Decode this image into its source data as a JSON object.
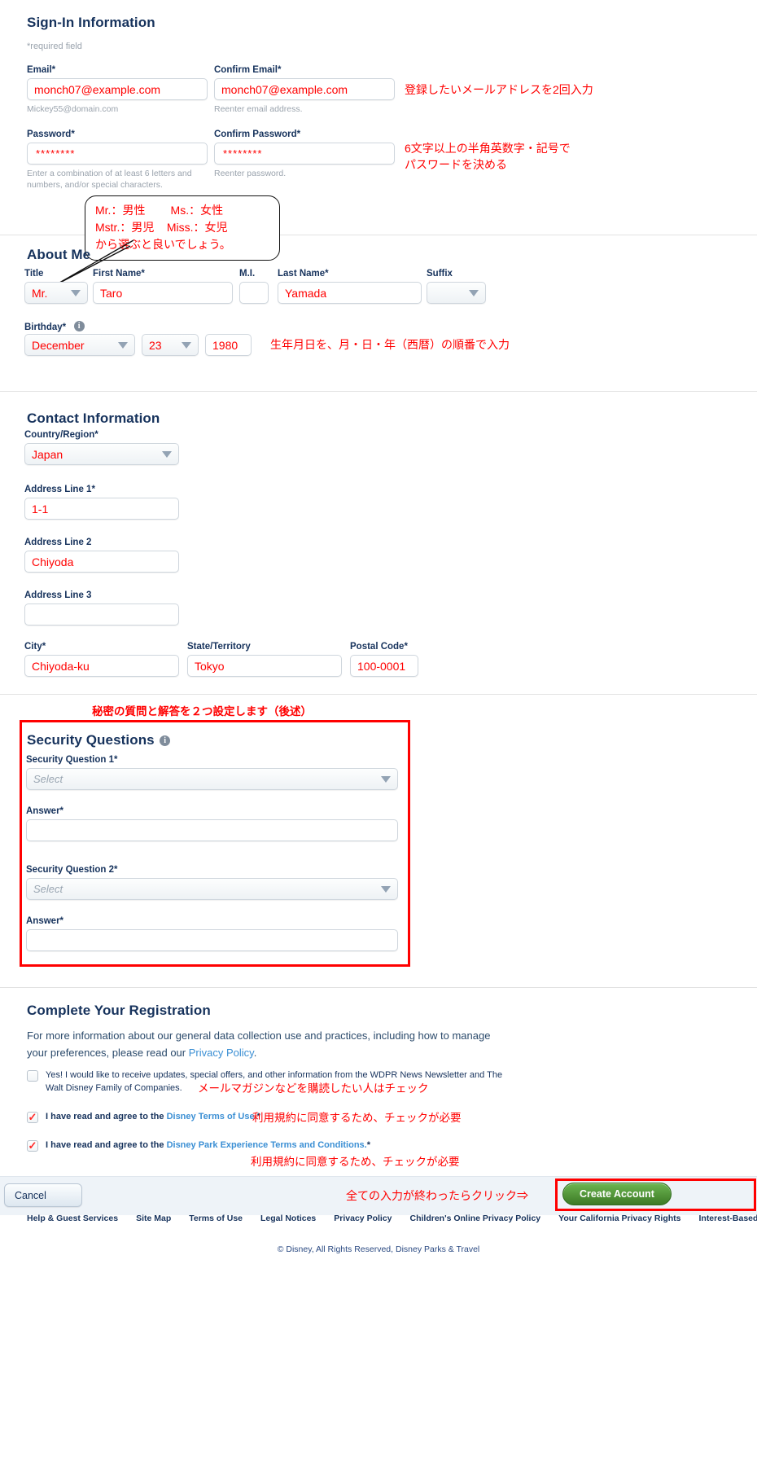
{
  "signin": {
    "heading": "Sign-In Information",
    "required_note": "*required field",
    "email_label": "Email*",
    "email_value": "monch07@example.com",
    "email_hint": "Mickey55@domain.com",
    "confirm_email_label": "Confirm Email*",
    "confirm_email_value": "monch07@example.com",
    "confirm_email_hint": "Reenter email address.",
    "password_label": "Password*",
    "password_value": "********",
    "password_hint": "Enter a combination of at least 6 letters and numbers, and/or special characters.",
    "confirm_password_label": "Confirm Password*",
    "confirm_password_value": "********",
    "confirm_password_hint": "Reenter password.",
    "anno_email": "登録したいメールアドレスを2回入力",
    "anno_password": "6文字以上の半角英数字・記号で\nパスワードを決める"
  },
  "about": {
    "heading": "About Me",
    "title_label": "Title",
    "title_value": "Mr.",
    "first_label": "First Name*",
    "first_value": "Taro",
    "mi_label": "M.I.",
    "mi_value": "",
    "last_label": "Last Name*",
    "last_value": "Yamada",
    "suffix_label": "Suffix",
    "suffix_value": "",
    "birthday_label": "Birthday*",
    "birth_month": "December",
    "birth_day": "23",
    "birth_year": "1980",
    "anno_birthday": "生年月日を、月・日・年（西暦）の順番で入力",
    "bubble": "Mr.：男性        Ms.：女性\nMstr.：男児    Miss.：女児\nから選ぶと良いでしょう。"
  },
  "contact": {
    "heading": "Contact Information",
    "country_label": "Country/Region*",
    "country_value": "Japan",
    "addr1_label": "Address Line 1*",
    "addr1_value": "1-1",
    "addr2_label": "Address Line 2",
    "addr2_value": "Chiyoda",
    "addr3_label": "Address Line 3",
    "addr3_value": "",
    "city_label": "City*",
    "city_value": "Chiyoda-ku",
    "state_label": "State/Territory",
    "state_value": "Tokyo",
    "postal_label": "Postal Code*",
    "postal_value": "100-0001"
  },
  "security": {
    "anno_above": "秘密の質問と解答を２つ設定します（後述）",
    "heading": "Security Questions",
    "q1_label": "Security Question 1*",
    "q1_value": "Select",
    "a1_label": "Answer*",
    "a1_value": "",
    "q2_label": "Security Question 2*",
    "q2_value": "Select",
    "a2_label": "Answer*",
    "a2_value": ""
  },
  "registration": {
    "heading": "Complete Your Registration",
    "intro_1": "For more information about our general data collection use and practices, including how to manage",
    "intro_2_pre": "your preferences, please read our ",
    "intro_2_link": "Privacy Policy",
    "intro_2_post": ".",
    "cb1_line1": "Yes! I would like to receive updates, special offers, and other information from the WDPR News Newsletter and The",
    "cb1_line2": "Walt Disney Family of Companies.",
    "cb1_checked": false,
    "cb2_pre": "I have read and agree to the ",
    "cb2_link": "Disney Terms of Use.",
    "cb2_post": "*",
    "cb2_checked": true,
    "cb3_pre": "I have read and agree to the ",
    "cb3_link": "Disney Park Experience Terms and Conditions.",
    "cb3_post": "*",
    "cb3_checked": true,
    "anno_newsletter": "メールマガジンなどを購読したい人はチェック",
    "anno_terms1": "利用規約に同意するため、チェックが必要",
    "anno_terms2": "利用規約に同意するため、チェックが必要"
  },
  "footer": {
    "cancel_label": "Cancel",
    "create_label": "Create Account",
    "anno_create": "全ての入力が終わったらクリック⇒",
    "links": [
      "Help & Guest Services",
      "Site Map",
      "Terms of Use",
      "Legal Notices",
      "Privacy Policy",
      "Children's Online Privacy Policy",
      "Your California Privacy Rights",
      "Interest-Based Ads"
    ],
    "copyright": "© Disney, All Rights Reserved, Disney Parks & Travel"
  },
  "colors": {
    "heading": "#16325c",
    "annotation_red": "#ff0000",
    "link_blue": "#3b8fd4",
    "create_green": "#4f9c34"
  }
}
